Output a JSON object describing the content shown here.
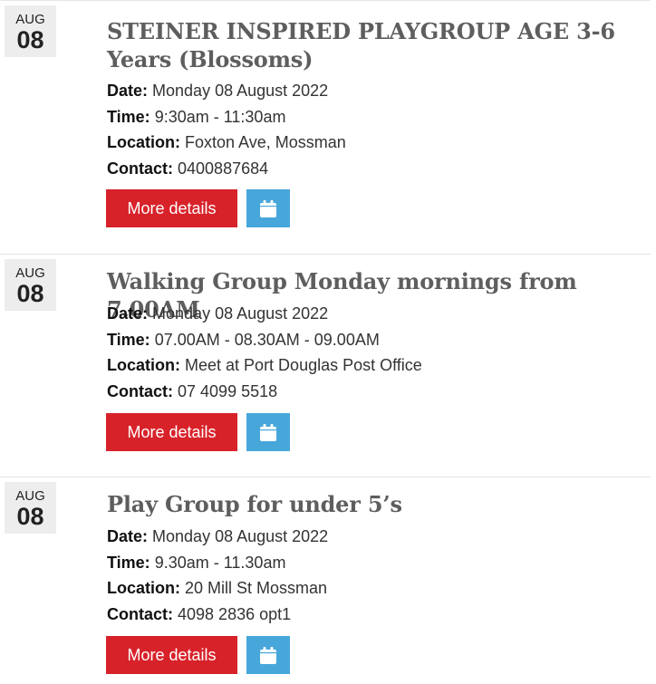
{
  "events": [
    {
      "month": "AUG",
      "day": "08",
      "title": "STEINER INSPIRED PLAYGROUP AGE 3-6 Years (Blossoms)",
      "date_label": "Date:",
      "date": "Monday 08 August 2022",
      "time_label": "Time:",
      "time": "9:30am - 11:30am",
      "location_label": "Location:",
      "location": "Foxton Ave, Mossman",
      "contact_label": "Contact:",
      "contact": "0400887684",
      "button_label": "More details",
      "calendar_icon": "calendar-icon"
    },
    {
      "month": "AUG",
      "day": "08",
      "title": "Walking Group Monday mornings from 7.00AM",
      "date_label": "Date:",
      "date": "Monday 08 August 2022",
      "time_label": "Time:",
      "time": "07.00AM - 08.30AM - 09.00AM",
      "location_label": "Location:",
      "location": "Meet at Port Douglas Post Office",
      "contact_label": "Contact:",
      "contact": "07 4099 5518",
      "button_label": "More details",
      "calendar_icon": "calendar-icon"
    },
    {
      "month": "AUG",
      "day": "08",
      "title": "Play Group for under 5’s",
      "date_label": "Date:",
      "date": "Monday 08 August 2022",
      "time_label": "Time:",
      "time": "9.30am - 11.30am",
      "location_label": "Location:",
      "location": "20 Mill St Mossman",
      "contact_label": "Contact:",
      "contact": "4098 2836 opt1",
      "button_label": "More details",
      "calendar_icon": "calendar-icon"
    }
  ],
  "colors": {
    "button_red": "#d8222a",
    "calendar_blue": "#48a7da",
    "badge_bg": "#ededed",
    "title_gray": "#5e5e5e"
  }
}
